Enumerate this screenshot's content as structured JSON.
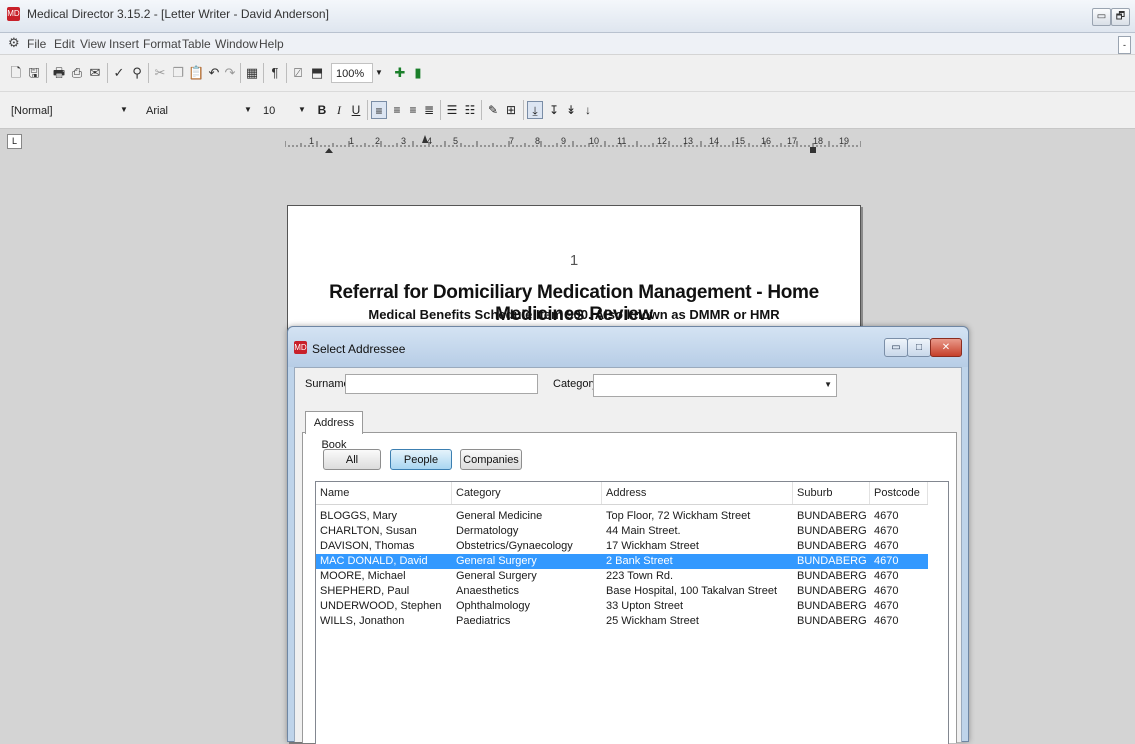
{
  "app": {
    "title": "Medical Director 3.15.2 - [Letter Writer - David Anderson]",
    "icon": "medical-director-icon",
    "accent_color": "#c8202a"
  },
  "window_controls": {
    "minimize": "▭",
    "restore": "🗗",
    "mdi_restore": "-"
  },
  "menu": {
    "items": [
      "File",
      "Edit",
      "View",
      "Insert",
      "Format",
      "Table",
      "Window",
      "Help"
    ]
  },
  "toolbar": {
    "zoom": "100%",
    "style": "[Normal]",
    "font": "Arial",
    "font_size": "10",
    "bold": "B",
    "italic": "I",
    "underline": "U"
  },
  "ruler": {
    "numbers": [
      "1",
      "1",
      "2",
      "3",
      "4",
      "5",
      "7",
      "8",
      "9",
      "10",
      "11",
      "12",
      "13",
      "14",
      "15",
      "16",
      "17",
      "18",
      "19"
    ]
  },
  "document": {
    "page_number": "1",
    "title": "Referral for Domiciliary Medication Management - Home Medicines Review",
    "subtitle": "Medical Benefits Schedule Item 900. Also known as DMMR or HMR"
  },
  "dialog": {
    "title": "Select Addressee",
    "surname_label": "Surname:",
    "surname_value": "",
    "category_label": "Category:",
    "category_value": "",
    "tab_label": "Address Book",
    "filters": [
      "All",
      "People",
      "Companies"
    ],
    "active_filter": "People",
    "columns": [
      "Name",
      "Category",
      "Address",
      "Suburb",
      "Postcode"
    ],
    "selection_color": "#3399ff",
    "rows": [
      {
        "name": "BLOGGS, Mary",
        "category": "General Medicine",
        "address": "Top Floor, 72 Wickham Street",
        "suburb": "BUNDABERG",
        "postcode": "4670",
        "selected": false
      },
      {
        "name": "CHARLTON, Susan",
        "category": "Dermatology",
        "address": "44 Main Street.",
        "suburb": "BUNDABERG",
        "postcode": "4670",
        "selected": false
      },
      {
        "name": "DAVISON, Thomas",
        "category": "Obstetrics/Gynaecology",
        "address": "17 Wickham Street",
        "suburb": "BUNDABERG",
        "postcode": "4670",
        "selected": false
      },
      {
        "name": "MAC DONALD, David",
        "category": "General Surgery",
        "address": "2 Bank Street",
        "suburb": "BUNDABERG",
        "postcode": "4670",
        "selected": true
      },
      {
        "name": "MOORE, Michael",
        "category": "General Surgery",
        "address": "223 Town Rd.",
        "suburb": "BUNDABERG",
        "postcode": "4670",
        "selected": false
      },
      {
        "name": "SHEPHERD, Paul",
        "category": "Anaesthetics",
        "address": "Base Hospital, 100 Takalvan Street",
        "suburb": "BUNDABERG",
        "postcode": "4670",
        "selected": false
      },
      {
        "name": "UNDERWOOD, Stephen",
        "category": "Ophthalmology",
        "address": "33 Upton Street",
        "suburb": "BUNDABERG",
        "postcode": "4670",
        "selected": false
      },
      {
        "name": "WILLS, Jonathon",
        "category": "Paediatrics",
        "address": "25 Wickham Street",
        "suburb": "BUNDABERG",
        "postcode": "4670",
        "selected": false
      }
    ]
  }
}
